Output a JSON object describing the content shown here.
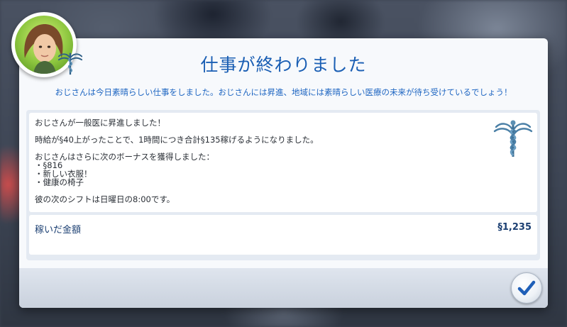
{
  "dialog": {
    "title": "仕事が終わりました",
    "subtitle": "おじさんは今日素晴らしい仕事をしました。おじさんには昇進、地域には素晴らしい医療の未来が待ち受けているでしょう！",
    "message_lines": [
      "おじさんが一般医に昇進しました！",
      "",
      "時給が§40上がったことで、1時間につき合計§135稼げるようになりました。",
      "",
      "おじさんはさらに次のボーナスを獲得しました：",
      "・§816",
      "・新しい衣服！",
      "・健康の椅子",
      "",
      "彼の次のシフトは日曜日の8:00です。"
    ],
    "earnings_label": "稼いだ金額",
    "earnings_value": "§1,235",
    "career_icon": "medical-caduceus-icon",
    "ok_icon": "checkmark-icon"
  },
  "colors": {
    "title": "#1b5fb4",
    "accent": "#1f66c2",
    "emblem": "#5b8fb3"
  }
}
